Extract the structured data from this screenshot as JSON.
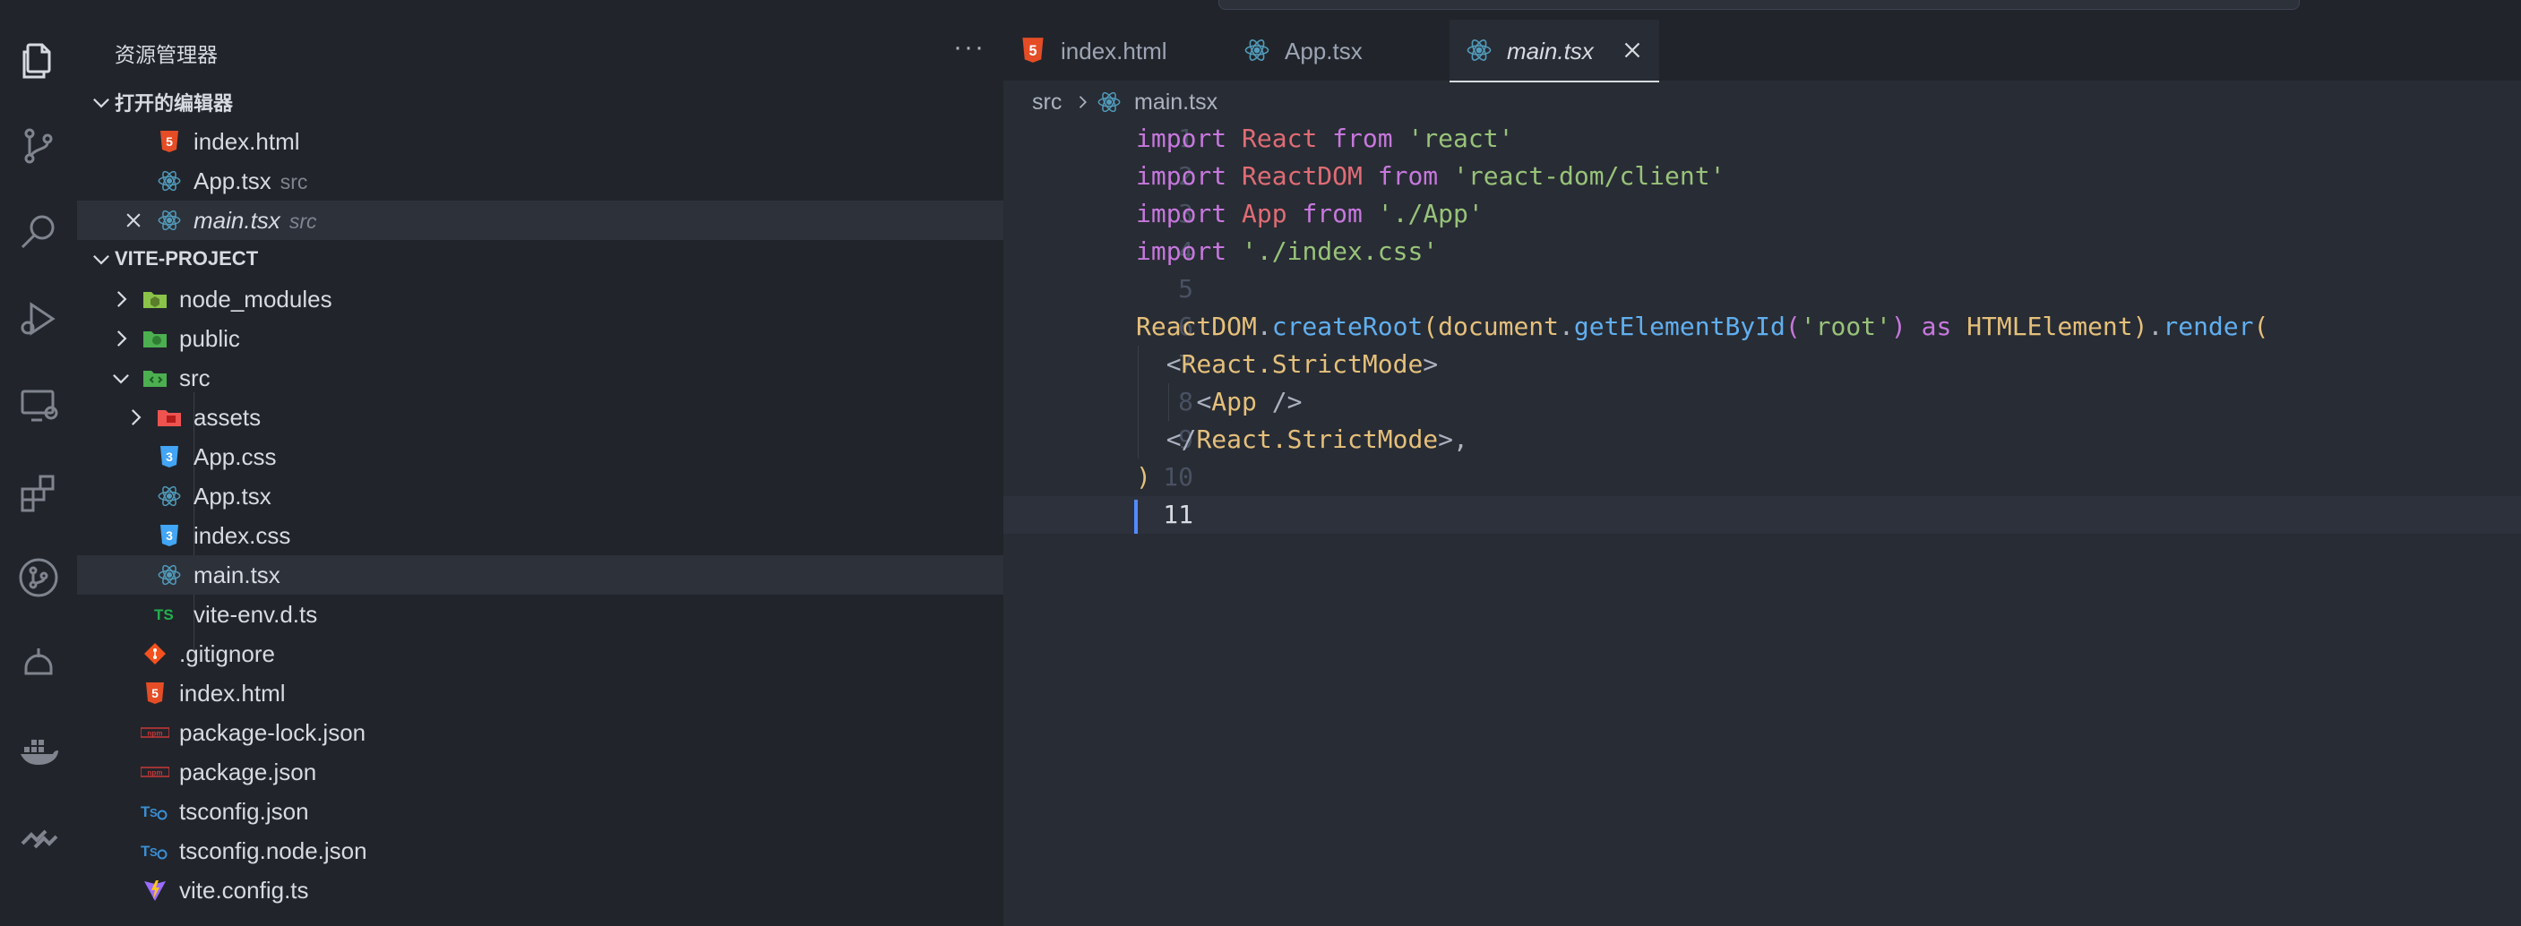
{
  "explorer": {
    "title": "资源管理器",
    "more": "···",
    "open_editors": {
      "header": "打开的编辑器",
      "items": [
        {
          "name": "index.html",
          "desc": "",
          "icon": "html5-icon"
        },
        {
          "name": "App.tsx",
          "desc": "src",
          "icon": "react-icon"
        },
        {
          "name": "main.tsx",
          "desc": "src",
          "icon": "react-icon",
          "active": true
        }
      ]
    },
    "project": {
      "header": "VITE-PROJECT",
      "items": [
        {
          "name": "node_modules",
          "icon": "node-folder-icon"
        },
        {
          "name": "public",
          "icon": "public-folder-icon"
        },
        {
          "name": "src",
          "icon": "src-folder-icon"
        },
        {
          "name": "assets",
          "icon": "assets-folder-icon"
        },
        {
          "name": "App.css",
          "icon": "css3-icon"
        },
        {
          "name": "App.tsx",
          "icon": "react-icon"
        },
        {
          "name": "index.css",
          "icon": "css3-icon"
        },
        {
          "name": "main.tsx",
          "icon": "react-icon"
        },
        {
          "name": "vite-env.d.ts",
          "icon": "typescript-def-icon"
        },
        {
          "name": ".gitignore",
          "icon": "git-icon"
        },
        {
          "name": "index.html",
          "icon": "html5-icon"
        },
        {
          "name": "package-lock.json",
          "icon": "npm-icon"
        },
        {
          "name": "package.json",
          "icon": "npm-icon"
        },
        {
          "name": "tsconfig.json",
          "icon": "tsconfig-icon"
        },
        {
          "name": "tsconfig.node.json",
          "icon": "tsconfig-icon"
        },
        {
          "name": "vite.config.ts",
          "icon": "vite-icon"
        }
      ]
    }
  },
  "tabs": [
    {
      "label": "index.html",
      "icon": "html5-icon"
    },
    {
      "label": "App.tsx",
      "icon": "react-icon"
    },
    {
      "label": "main.tsx",
      "icon": "react-icon",
      "active": true
    }
  ],
  "breadcrumb": {
    "folder": "src",
    "file": "main.tsx"
  },
  "code": {
    "line_numbers": [
      "1",
      "2",
      "3",
      "4",
      "5",
      "6",
      "7",
      "8",
      "9",
      "10",
      "11"
    ],
    "lines": [
      [
        {
          "t": "import",
          "c": "kw"
        },
        {
          "t": " ",
          "c": "pun"
        },
        {
          "t": "React",
          "c": "id"
        },
        {
          "t": " ",
          "c": "pun"
        },
        {
          "t": "from",
          "c": "kw"
        },
        {
          "t": " ",
          "c": "pun"
        },
        {
          "t": "'react'",
          "c": "str"
        }
      ],
      [
        {
          "t": "import",
          "c": "kw"
        },
        {
          "t": " ",
          "c": "pun"
        },
        {
          "t": "ReactDOM",
          "c": "id"
        },
        {
          "t": " ",
          "c": "pun"
        },
        {
          "t": "from",
          "c": "kw"
        },
        {
          "t": " ",
          "c": "pun"
        },
        {
          "t": "'react-dom/client'",
          "c": "str"
        }
      ],
      [
        {
          "t": "import",
          "c": "kw"
        },
        {
          "t": " ",
          "c": "pun"
        },
        {
          "t": "App",
          "c": "id"
        },
        {
          "t": " ",
          "c": "pun"
        },
        {
          "t": "from",
          "c": "kw"
        },
        {
          "t": " ",
          "c": "pun"
        },
        {
          "t": "'./App'",
          "c": "str"
        }
      ],
      [
        {
          "t": "import",
          "c": "kw"
        },
        {
          "t": " ",
          "c": "pun"
        },
        {
          "t": "'./index.css'",
          "c": "str"
        }
      ],
      [],
      [
        {
          "t": "ReactDOM",
          "c": "obj"
        },
        {
          "t": ".",
          "c": "pun"
        },
        {
          "t": "createRoot",
          "c": "fn"
        },
        {
          "t": "(",
          "c": "obj"
        },
        {
          "t": "document",
          "c": "obj"
        },
        {
          "t": ".",
          "c": "pun"
        },
        {
          "t": "getElementById",
          "c": "fn"
        },
        {
          "t": "(",
          "c": "kw"
        },
        {
          "t": "'root'",
          "c": "str"
        },
        {
          "t": ")",
          "c": "kw"
        },
        {
          "t": " ",
          "c": "pun"
        },
        {
          "t": "as",
          "c": "kw"
        },
        {
          "t": " ",
          "c": "pun"
        },
        {
          "t": "HTMLElement",
          "c": "obj"
        },
        {
          "t": ")",
          "c": "obj"
        },
        {
          "t": ".",
          "c": "pun"
        },
        {
          "t": "render",
          "c": "fn"
        },
        {
          "t": "(",
          "c": "obj"
        }
      ],
      [
        {
          "t": "  ",
          "c": "pun"
        },
        {
          "t": "<",
          "c": "pun"
        },
        {
          "t": "React.StrictMode",
          "c": "obj"
        },
        {
          "t": ">",
          "c": "pun"
        }
      ],
      [
        {
          "t": "    ",
          "c": "pun"
        },
        {
          "t": "<",
          "c": "pun"
        },
        {
          "t": "App",
          "c": "obj"
        },
        {
          "t": " />",
          "c": "pun"
        }
      ],
      [
        {
          "t": "  ",
          "c": "pun"
        },
        {
          "t": "</",
          "c": "pun"
        },
        {
          "t": "React.StrictMode",
          "c": "obj"
        },
        {
          "t": ">,",
          "c": "pun"
        }
      ],
      [
        {
          "t": ")",
          "c": "obj"
        }
      ],
      []
    ]
  }
}
